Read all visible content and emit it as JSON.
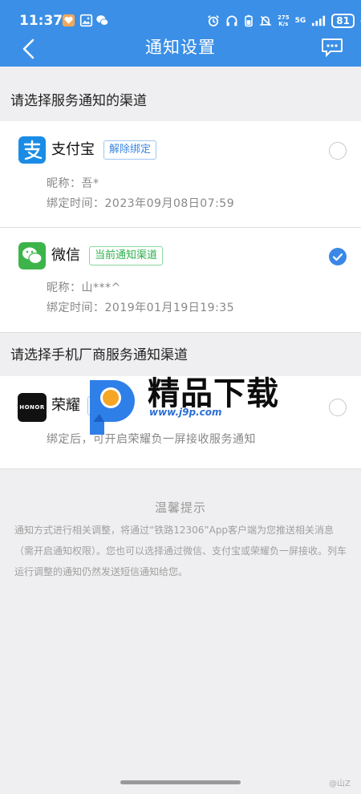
{
  "status": {
    "time": "11:37",
    "speed_top": "275",
    "speed_bottom": "K/s",
    "network": "5G",
    "battery": "81"
  },
  "nav": {
    "title": "通知设置"
  },
  "section1": {
    "heading": "请选择服务通知的渠道",
    "alipay": {
      "name": "支付宝",
      "tag": "解除绑定",
      "nickname": "昵称：吾*",
      "bind_time": "绑定时间：2023年09月08日07:59",
      "selected": false
    },
    "wechat": {
      "name": "微信",
      "tag": "当前通知渠道",
      "nickname": "昵称：山***^",
      "bind_time": "绑定时间：2019年01月19日19:35",
      "selected": true
    }
  },
  "section2": {
    "heading": "请选择手机厂商服务通知渠道",
    "honor": {
      "logo_text": "HONOR",
      "name": "荣耀",
      "tag": "绑定",
      "desc": "绑定后，可开启荣耀负一屏接收服务通知",
      "selected": false
    }
  },
  "watermark": {
    "text": "精品下载",
    "url": "www.j9p.com"
  },
  "tips": {
    "title": "温馨提示",
    "body": "通知方式进行相关调整，将通过“铁路12306”App客户端为您推送相关消息（需开启通知权限）。您也可以选择通过微信、支付宝或荣耀负一屏接收。列车运行调整的通知仍然发送短信通知给您。"
  },
  "corner": "@山Z",
  "colors": {
    "header": "#3b8fe6",
    "accent_blue": "#3a87e2",
    "accent_green": "#2eb04e",
    "background": "#efeff1"
  }
}
